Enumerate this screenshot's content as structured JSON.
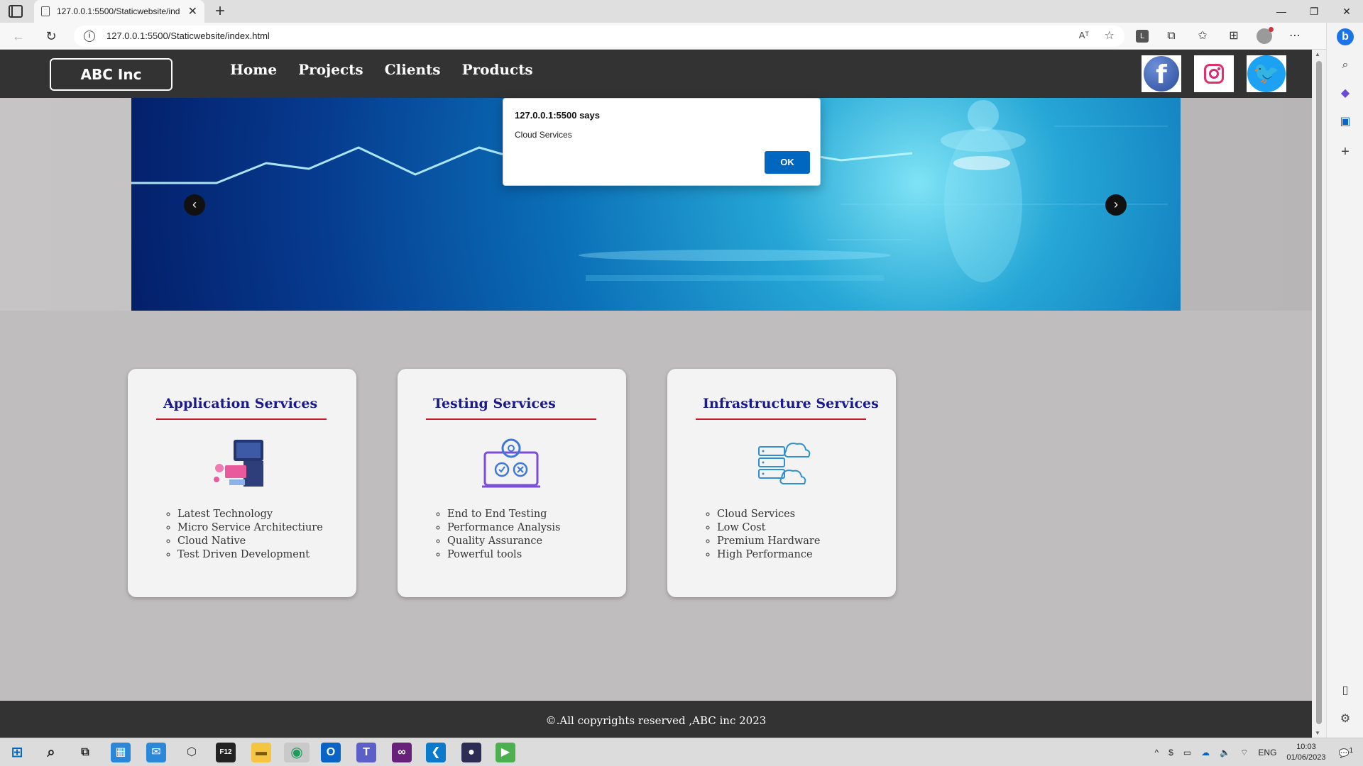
{
  "browser": {
    "tab_title": "127.0.0.1:5500/Staticwebsite/ind",
    "new_tab": "+",
    "url": "127.0.0.1:5500/Staticwebsite/index.html",
    "profile_letter": "L",
    "read_aloud": "Aᵀ"
  },
  "site": {
    "logo": "ABC Inc",
    "nav": [
      "Home",
      "Projects",
      "Clients",
      "Products"
    ],
    "socials": [
      "facebook",
      "instagram",
      "twitter"
    ],
    "carousel_prev": "‹",
    "carousel_next": "›",
    "footer": "©.All copyrights reserved ,ABC inc 2023"
  },
  "cards": [
    {
      "title": "Application Services",
      "icon": "app-dev-illustration",
      "items": [
        "Latest Technology",
        "Micro Service Architectiure",
        "Cloud Native",
        "Test Driven Development"
      ]
    },
    {
      "title": "Testing Services",
      "icon": "gear-laptop-illustration",
      "items": [
        "End to End Testing",
        "Performance Analysis",
        "Quality Assurance",
        "Powerful tools"
      ]
    },
    {
      "title": "Infrastructure Services",
      "icon": "server-cloud-illustration",
      "items": [
        "Cloud Services",
        "Low Cost",
        "Premium Hardware",
        "High Performance"
      ]
    }
  ],
  "alert": {
    "title": "127.0.0.1:5500 says",
    "message": "Cloud Services",
    "ok": "OK"
  },
  "taskbar": {
    "lang": "ENG",
    "time": "10:03",
    "date": "01/06/2023",
    "notifications": "1"
  }
}
